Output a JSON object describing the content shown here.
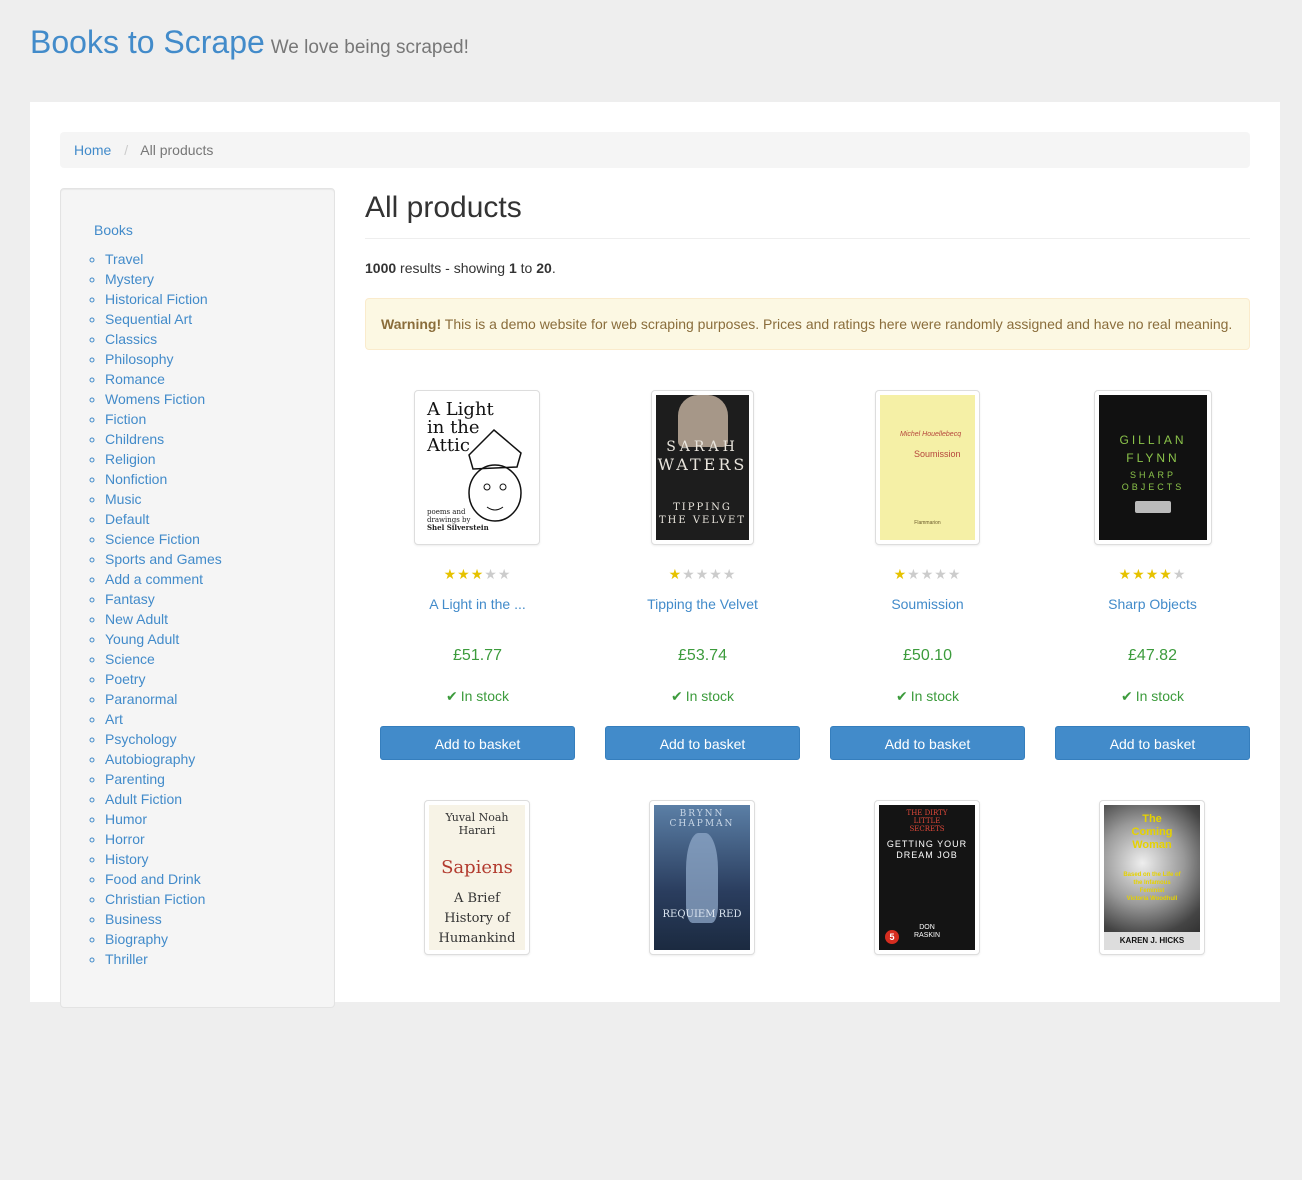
{
  "header": {
    "brand": "Books to Scrape",
    "tagline": "We love being scraped!"
  },
  "breadcrumb": {
    "home": "Home",
    "current": "All products"
  },
  "sidebar": {
    "root_label": "Books",
    "categories": [
      "Travel",
      "Mystery",
      "Historical Fiction",
      "Sequential Art",
      "Classics",
      "Philosophy",
      "Romance",
      "Womens Fiction",
      "Fiction",
      "Childrens",
      "Religion",
      "Nonfiction",
      "Music",
      "Default",
      "Science Fiction",
      "Sports and Games",
      "Add a comment",
      "Fantasy",
      "New Adult",
      "Young Adult",
      "Science",
      "Poetry",
      "Paranormal",
      "Art",
      "Psychology",
      "Autobiography",
      "Parenting",
      "Adult Fiction",
      "Humor",
      "Horror",
      "History",
      "Food and Drink",
      "Christian Fiction",
      "Business",
      "Biography",
      "Thriller"
    ]
  },
  "main": {
    "title": "All products",
    "results": {
      "total": "1000",
      "text1": " results - showing ",
      "from": "1",
      "text2": " to ",
      "to": "20",
      "text3": "."
    },
    "alert": {
      "label": "Warning!",
      "message": " This is a demo website for web scraping purposes. Prices and ratings here were randomly assigned and have no real meaning."
    }
  },
  "products": [
    {
      "title": "A Light in the ...",
      "price": "£51.77",
      "rating": 3,
      "stock": "In stock",
      "button": "Add to basket",
      "cover": {
        "lines": [
          "A Light",
          "in the",
          "Attic"
        ],
        "sub": [
          "poems and",
          "drawings by",
          "Shel Silverstein"
        ]
      }
    },
    {
      "title": "Tipping the Velvet",
      "price": "£53.74",
      "rating": 1,
      "stock": "In stock",
      "button": "Add to basket",
      "cover": {
        "author1": "SARAH",
        "author2": "WATERS",
        "lines": [
          "TIPPING",
          "THE VELVET"
        ]
      }
    },
    {
      "title": "Soumission",
      "price": "£50.10",
      "rating": 1,
      "stock": "In stock",
      "button": "Add to basket",
      "cover": {
        "author": "Michel Houellebecq",
        "title": "Soumission",
        "publisher": "Flammarion"
      }
    },
    {
      "title": "Sharp Objects",
      "price": "£47.82",
      "rating": 4,
      "stock": "In stock",
      "button": "Add to basket",
      "cover": {
        "author": [
          "GILLIAN",
          "FLYNN"
        ],
        "title": [
          "SHARP",
          "OBJECTS"
        ]
      }
    },
    {
      "cover": {
        "author": [
          "Yuval Noah",
          "Harari"
        ],
        "title": "Sapiens",
        "sub": [
          "A Brief",
          "History of",
          "Humankind"
        ]
      }
    },
    {
      "cover": {
        "author": "BRYNN CHAPMAN",
        "title": "REQUIEM RED"
      }
    },
    {
      "cover": {
        "kicker": [
          "THE DIRTY",
          "LITTLE",
          "SECRETS"
        ],
        "title": [
          "GETTING YOUR",
          "DREAM JOB"
        ],
        "badge": "5",
        "author": [
          "DON",
          "RASKIN"
        ]
      }
    },
    {
      "cover": {
        "title": [
          "The",
          "Coming",
          "Woman"
        ],
        "sub": [
          "Based on the Life of",
          "the Infamous",
          "Feminist",
          "Victoria Woodhull"
        ],
        "author": "KAREN J. HICKS"
      }
    }
  ],
  "colors": {
    "accent": "#428bca",
    "stock_green": "#3c9b3c",
    "star": "#e6c200",
    "warning_bg": "#fcf8e3",
    "warning_text": "#8a6d3b"
  }
}
